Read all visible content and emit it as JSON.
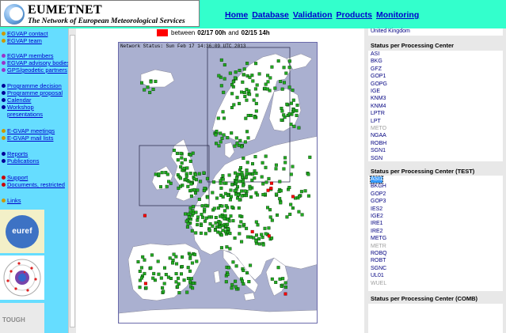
{
  "header": {
    "logo_title": "EUMETNET",
    "logo_subtitle": "The Network of European Meteorological Services",
    "nav": [
      "Home",
      "Database",
      "Validation",
      "Products",
      "Monitoring"
    ]
  },
  "sidebar": {
    "items": [
      {
        "label": "EGVAP contact",
        "bullet": "#cc9900"
      },
      {
        "label": "EGVAP team",
        "bullet": "#cc9900"
      },
      {
        "label": "EGVAP members",
        "bullet": "#9933cc"
      },
      {
        "label": "EGVAP advisory bodies",
        "bullet": "#9933cc"
      },
      {
        "label": "GPS/geodetic partners",
        "bullet": "#9933cc"
      },
      {
        "label": "Programme decision",
        "bullet": "#000099"
      },
      {
        "label": "Programme proposal",
        "bullet": "#000099"
      },
      {
        "label": "Calendar",
        "bullet": "#000099"
      },
      {
        "label": "Workshop presentations",
        "bullet": "#000099"
      },
      {
        "label": "E-GVAP meetings",
        "bullet": "#cc9900"
      },
      {
        "label": "E-GVAP mail lists",
        "bullet": "#cc9900"
      },
      {
        "label": "Reports",
        "bullet": "#000099"
      },
      {
        "label": "Publications",
        "bullet": "#000099"
      },
      {
        "label": "Support",
        "bullet": "#cc0000"
      },
      {
        "label": "Documents, restricted",
        "bullet": "#cc0000"
      },
      {
        "label": "Links",
        "bullet": "#cc9900"
      }
    ],
    "logos": {
      "euref": "euref",
      "tough": "TOUGH"
    }
  },
  "main": {
    "time_text_before": "between",
    "time_start": "02/17 00h",
    "time_text_and": "and",
    "time_end": "02/15 14h",
    "map_status": "Network Status: Sun Feb 17 14:36:09 UTC 2013",
    "colors": {
      "sea": "#aab0d0",
      "land": "#ffffff",
      "station_ok": "#22aa22",
      "station_bad": "#ff0000"
    }
  },
  "right": {
    "top_item": "United Kingdom",
    "section1": {
      "title": "Status per Processing Center",
      "items": [
        {
          "label": "ASI"
        },
        {
          "label": "BKG"
        },
        {
          "label": "GFZ"
        },
        {
          "label": "GOP1"
        },
        {
          "label": "GOPG"
        },
        {
          "label": "IGE"
        },
        {
          "label": "KNM3"
        },
        {
          "label": "KNM4"
        },
        {
          "label": "LPTR"
        },
        {
          "label": "LPT"
        },
        {
          "label": "METO",
          "grey": true
        },
        {
          "label": "NGAA"
        },
        {
          "label": "ROBH"
        },
        {
          "label": "SGN1"
        },
        {
          "label": "SGN"
        }
      ]
    },
    "section2": {
      "title": "Status per Processing Center (TEST)",
      "items": [
        {
          "label": "ASI1",
          "selected": true
        },
        {
          "label": "BKGH"
        },
        {
          "label": "GOP2"
        },
        {
          "label": "GOP3"
        },
        {
          "label": "IES2"
        },
        {
          "label": "IGE2"
        },
        {
          "label": "IRE1"
        },
        {
          "label": "IRE2"
        },
        {
          "label": "METG"
        },
        {
          "label": "METR",
          "grey": true
        },
        {
          "label": "ROBQ"
        },
        {
          "label": "ROBT"
        },
        {
          "label": "SGNC"
        },
        {
          "label": "UL01"
        },
        {
          "label": "WUEL",
          "grey": true
        }
      ]
    },
    "section3": {
      "title": "Status per Processing Center (COMB)"
    }
  }
}
